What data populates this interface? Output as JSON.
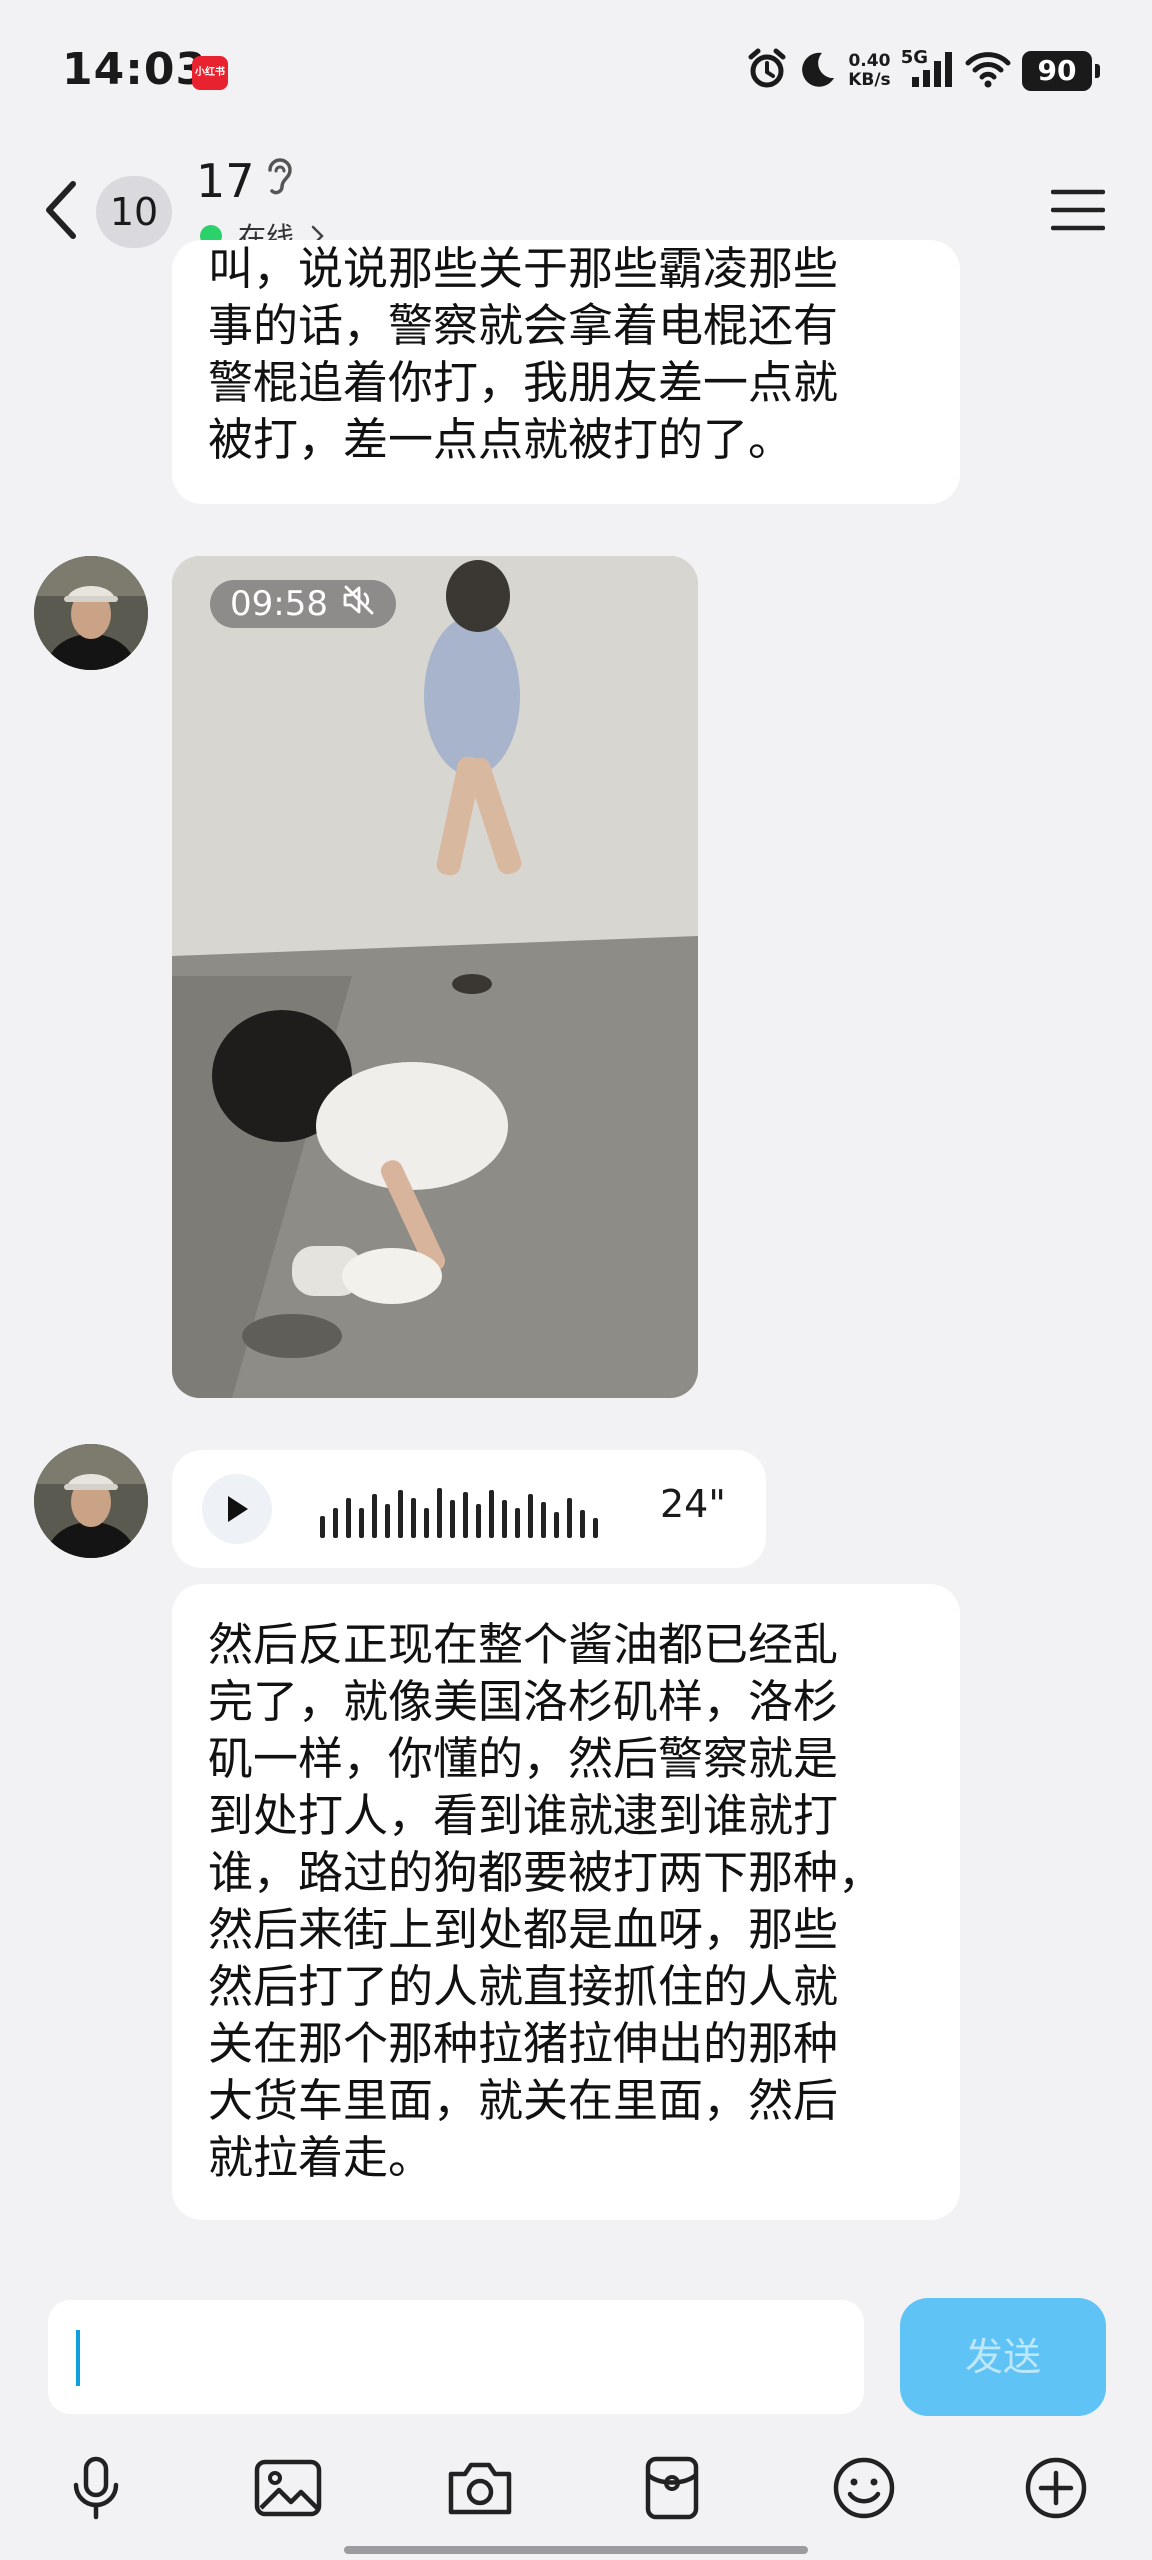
{
  "status_bar": {
    "time": "14:03",
    "app_badge": "小红书",
    "net_speed_value": "0.40",
    "net_speed_unit": "KB/s",
    "network": "5G",
    "battery": "90"
  },
  "header": {
    "unread_count": "10",
    "contact_name": "17",
    "presence": "在线"
  },
  "messages": {
    "top_text": "叫，说说那些关于那些霸凌那些\n事的话，警察就会拿着电棍还有\n警棍追着你打，我朋友差一点就\n被打，差一点点就被打的了。",
    "video_duration": "09:58",
    "voice_duration": "24\"",
    "long_text": "然后反正现在整个酱油都已经乱\n完了，就像美国洛杉矶样，洛杉\n矶一样，你懂的，然后警察就是\n到处打人，看到谁就逮到谁就打\n谁，路过的狗都要被打两下那种，\n然后来街上到处都是血呀，那些\n然后打了的人就直接抓住的人就\n关在那个那种拉猪拉伸出的那种\n大货车里面，就关在里面，然后\n就拉着走。"
  },
  "input": {
    "send_label": "发送"
  },
  "colors": {
    "accent": "#5fc3f5",
    "online": "#2bd16b",
    "background": "#f2f2f4"
  }
}
